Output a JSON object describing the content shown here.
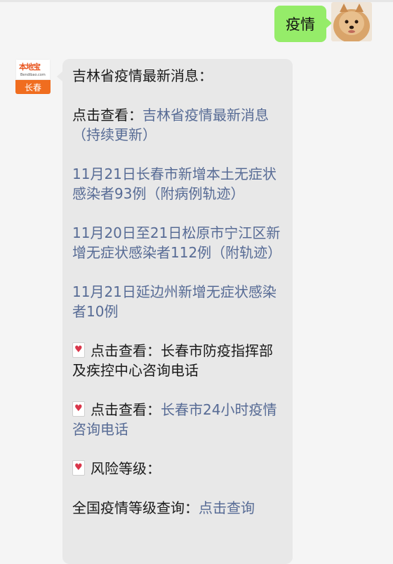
{
  "outgoing": {
    "text": "疫情"
  },
  "bot": {
    "logo_cn": "本地宝",
    "logo_en": "Bendibao.com",
    "logo_city": "长春"
  },
  "message": {
    "title": "吉林省疫情最新消息：",
    "item1_prefix": "点击查看：",
    "item1_link": "吉林省疫情最新消息（持续更新）",
    "link2": "11月21日长春市新增本土无症状感染者93例（附病例轨迹）",
    "link3": "11月20日至21日松原市宁江区新增无症状感染者112例（附轨迹）",
    "link4": "11月21日延边州新增无症状感染者10例",
    "item5_prefix": "点击查看：",
    "item5_text": "长春市防疫指挥部及疾控中心咨询电话",
    "item6_prefix": "点击查看：",
    "item6_link": "长春市24小时疫情咨询电话",
    "item7_text": "风险等级：",
    "item8_prefix": "全国疫情等级查询：",
    "item8_link": "点击查询"
  }
}
